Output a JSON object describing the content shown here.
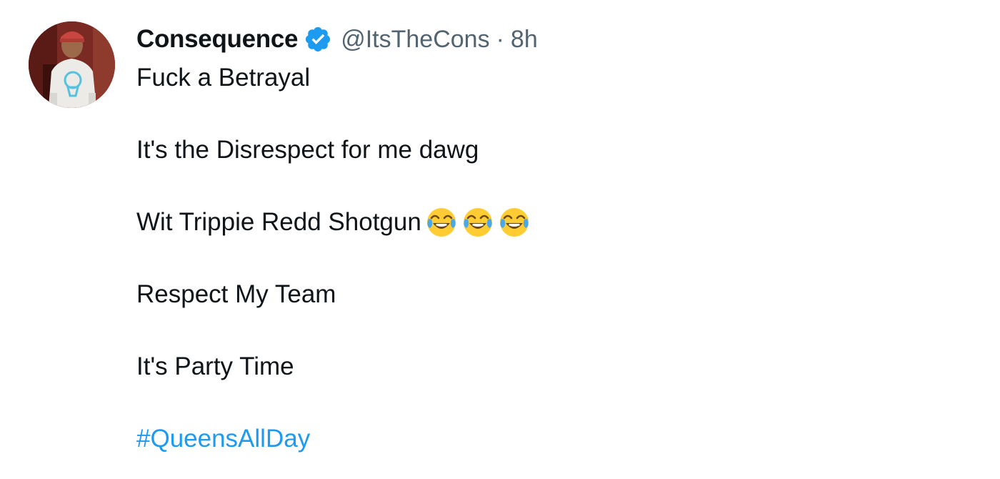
{
  "author": {
    "display_name": "Consequence",
    "handle": "@ItsTheCons",
    "separator": "·",
    "time": "8h",
    "verified_icon": "verified-badge-icon",
    "badge_color": "#1d9bf0"
  },
  "tweet": {
    "lines": [
      "Fuck a Betrayal",
      "It's the Disrespect for me dawg",
      "Wit Trippie Redd Shotgun",
      "Respect My Team",
      "It's Party Time"
    ],
    "emojis": [
      "face-with-tears-of-joy-icon",
      "face-with-tears-of-joy-icon",
      "face-with-tears-of-joy-icon"
    ],
    "hashtag": "#QueensAllDay",
    "hashtag_color": "#1d9bf0"
  }
}
